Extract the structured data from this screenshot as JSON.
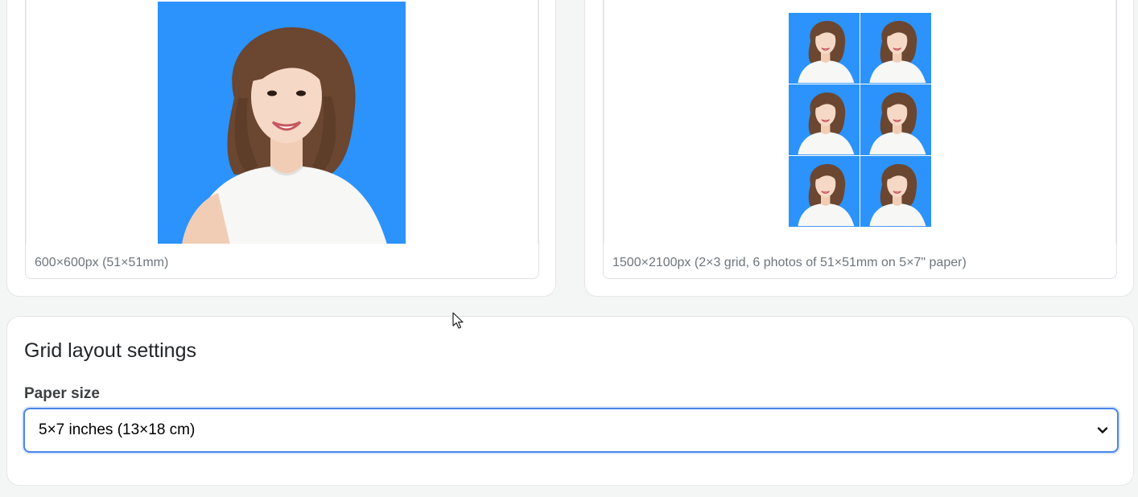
{
  "single_preview": {
    "caption": "600×600px (51×51mm)",
    "background_color": "#2b93fb"
  },
  "grid_preview": {
    "caption": "1500×2100px (2×3 grid, 6 photos of 51×51mm on 5×7\" paper)",
    "columns": 2,
    "rows": 3,
    "photo_count": 6
  },
  "settings": {
    "title": "Grid layout settings",
    "paper_size_label": "Paper size",
    "paper_size_value": "5×7 inches (13×18 cm)"
  },
  "colors": {
    "photo_background": "#2b93fb",
    "focus_border": "#4a86e8"
  },
  "icons": {
    "select_arrow": "chevron-down-icon",
    "cursor": "mouse-pointer-icon"
  }
}
